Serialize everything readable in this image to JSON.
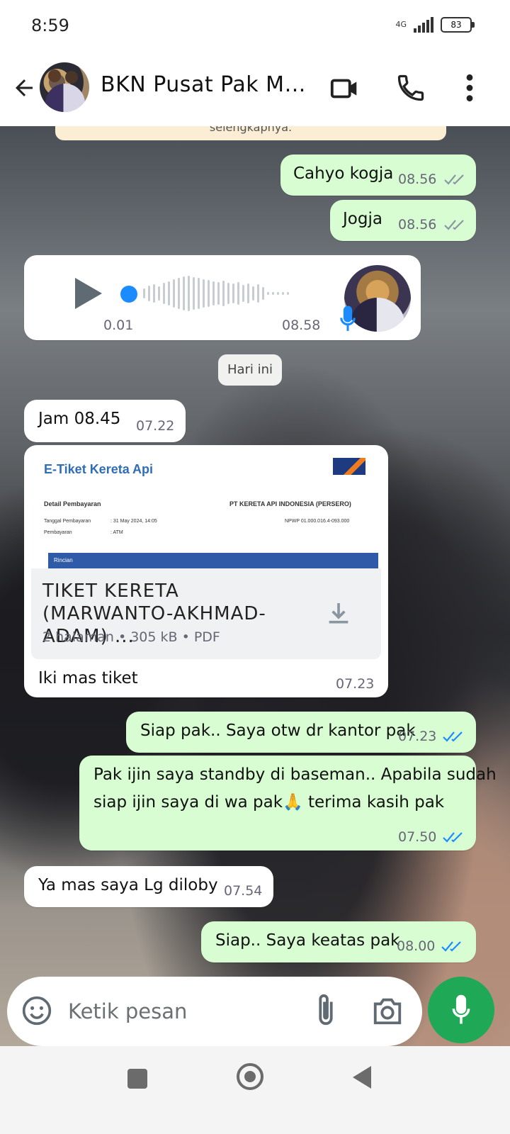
{
  "status": {
    "time": "8:59",
    "network": "4G",
    "battery": "83"
  },
  "header": {
    "contact_name": "BKN Pusat Pak Ma..."
  },
  "banner": {
    "text": "selengkapnya."
  },
  "messages": [
    {
      "direction": "out",
      "text": "Cahyo kogja",
      "time": "08.56",
      "status": "read"
    },
    {
      "direction": "out",
      "text": "Jogja",
      "time": "08.56",
      "status": "read"
    },
    {
      "direction": "in",
      "type": "voice",
      "duration": "0.01",
      "time": "08.58"
    },
    {
      "type": "date",
      "text": "Hari ini"
    },
    {
      "direction": "in",
      "text": "Jam 08.45",
      "time": "07.22"
    },
    {
      "direction": "in",
      "type": "document",
      "doc_preview": {
        "title": "E-Tiket Kereta Api",
        "section": "Detail Pembayaran",
        "company": "PT KERETA API INDONESIA (PERSERO)",
        "tanggal_label": "Tanggal Pembayaran",
        "tanggal_value": ": 31 May 2024, 14:05",
        "npwp": "NPWP 01.000.016.4-093.000",
        "pembayaran_label": "Pembayaran",
        "pembayaran_value": ": ATM",
        "rincian": "Rincian"
      },
      "filename": "TIKET KERETA (MARWANTO-AKHMAD-ADAM) ...",
      "meta": "2 halaman • 305 kB • PDF",
      "caption": "Iki mas tiket",
      "time": "07.23"
    },
    {
      "direction": "out",
      "text": "Siap pak.. Saya otw dr kantor pak",
      "time": "07.23",
      "status": "read"
    },
    {
      "direction": "out",
      "text_line1": "Pak ijin saya standby di baseman.. Apabila sudah",
      "text_line2": "siap ijin saya di wa pak🙏 terima kasih pak",
      "time": "07.50",
      "status": "read"
    },
    {
      "direction": "in",
      "text": "Ya mas saya Lg diloby",
      "time": "07.54"
    },
    {
      "direction": "out",
      "text": "Siap.. Saya keatas pak",
      "time": "08.00",
      "status": "read"
    }
  ],
  "composer": {
    "placeholder": "Ketik pesan"
  },
  "colors": {
    "accent": "#1fa855",
    "tick_read": "#1a8cff",
    "tick_sent": "#8a96a0",
    "outgoing": "#d9fdd3"
  },
  "icons": [
    "back-arrow-icon",
    "video-call-icon",
    "phone-icon",
    "more-vert-icon",
    "play-icon",
    "mic-icon",
    "download-icon",
    "emoji-icon",
    "attach-icon",
    "camera-icon"
  ]
}
